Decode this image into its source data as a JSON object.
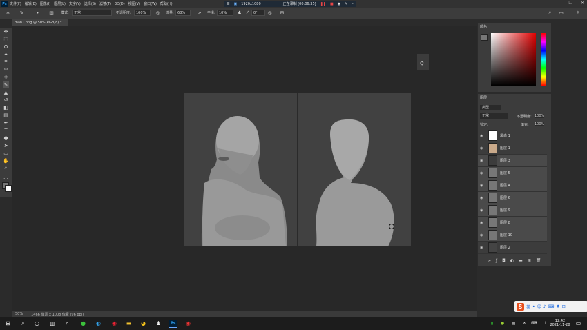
{
  "app": {
    "menu": [
      "文件(F)",
      "编辑(E)",
      "图像(I)",
      "图层(L)",
      "文字(Y)",
      "选择(S)",
      "滤镜(T)",
      "3D(D)",
      "视图(V)",
      "窗口(W)",
      "帮助(H)"
    ],
    "logo": "Ps"
  },
  "recorder": {
    "resolution": "1920x1080",
    "status": "正在录制 [00:06:35]"
  },
  "options_bar": {
    "mode_label": "模式:",
    "mode_value": "正常",
    "opacity_label": "不透明度:",
    "opacity_value": "100%",
    "flow_label": "流量:",
    "flow_value": "68%",
    "smoothing_label": "平滑:",
    "smoothing_value": "10%",
    "angle_value": "0°"
  },
  "document": {
    "tab_title": "man1.png @ 50%(RGB/8) *",
    "zoom": "50%",
    "size_info": "1466 像素 x 1008 像素 (96 ppi)"
  },
  "panels": {
    "color_title": "颜色",
    "layers_title": "图层",
    "filter_label": "类型",
    "blend_mode": "正常",
    "opacity_label": "不透明度:",
    "opacity_value": "100%",
    "lock_label": "锁定:",
    "fill_label": "填充:",
    "fill_value": "100%",
    "layers": [
      {
        "name": "黑白 1"
      },
      {
        "name": "图层 1"
      },
      {
        "name": "图层 3"
      },
      {
        "name": "图层 5"
      },
      {
        "name": "图层 4"
      },
      {
        "name": "图层 6"
      },
      {
        "name": "图层 9"
      },
      {
        "name": "图层 8"
      },
      {
        "name": "图层 10"
      },
      {
        "name": "图层 2"
      }
    ]
  },
  "taskbar": {
    "time": "12:42",
    "date": "2021-11-28"
  },
  "ime": {
    "label": "英"
  }
}
